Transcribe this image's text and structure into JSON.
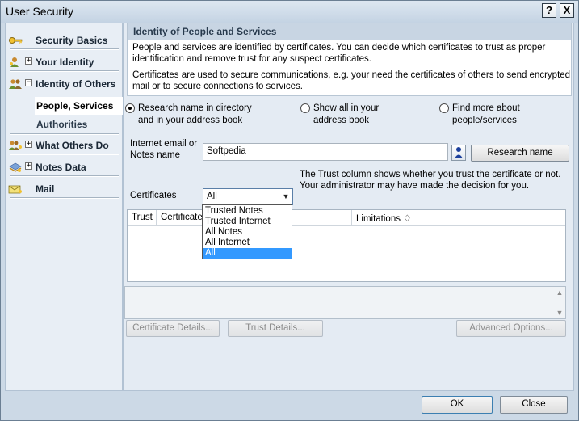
{
  "window": {
    "title": "User Security",
    "help_label": "?",
    "close_label": "X"
  },
  "sidebar": {
    "items": [
      {
        "label": "Security Basics",
        "icon": "key-icon"
      },
      {
        "label": "Your Identity",
        "expander": "+",
        "icon": "person-key-icon"
      },
      {
        "label": "Identity of Others",
        "expander": "−",
        "icon": "people-icon"
      },
      {
        "label": "People, Services",
        "sub": true,
        "active": true
      },
      {
        "label": "Authorities",
        "sub": true
      },
      {
        "label": "What Others Do",
        "expander": "+",
        "icon": "group-icon"
      },
      {
        "label": "Notes Data",
        "expander": "+",
        "icon": "notes-icon"
      },
      {
        "label": "Mail",
        "icon": "mail-icon"
      }
    ]
  },
  "main": {
    "section_title": "Identity of People and Services",
    "para1": "People and services are identified by certificates. You can decide which certificates to trust as proper identification and remove trust for any suspect certificates.",
    "para2": "Certificates are used to secure communications, e.g. your need the certificates of others to send encrypted mail or to secure connections to services.",
    "radios": [
      {
        "line1": "Research name in directory",
        "line2": "and in your address book",
        "checked": true
      },
      {
        "line1": "Show all in your",
        "line2": "address book",
        "checked": false
      },
      {
        "line1": "Find more about",
        "line2": "people/services",
        "checked": false
      }
    ],
    "email_label_1": "Internet email or",
    "email_label_2": "Notes name",
    "email_value": "Softpedia",
    "research_button": "Research name",
    "trust_note": "The Trust column shows whether you trust the certificate or not. Your administrator may have made the decision for you.",
    "certificates_label": "Certificates",
    "certificates_selected": "All",
    "certificates_options": [
      "Trusted Notes",
      "Trusted Internet",
      "All Notes",
      "All Internet",
      "All"
    ],
    "table_columns": [
      "Trust",
      "Certificate I",
      "",
      "Limitations ♢"
    ],
    "cert_details_button": "Certificate Details...",
    "trust_details_button": "Trust Details...",
    "advanced_button": "Advanced Options..."
  },
  "footer": {
    "ok_label": "OK",
    "close_label": "Close"
  }
}
